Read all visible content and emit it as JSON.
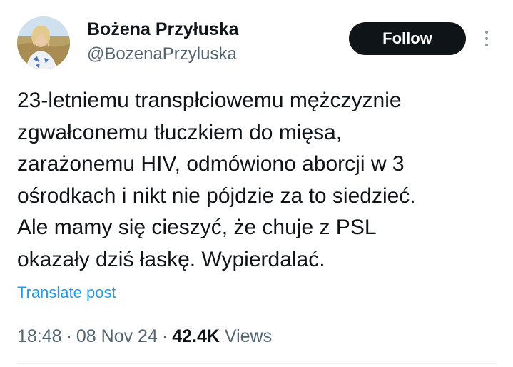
{
  "author": {
    "display_name": "Bożena Przyłuska",
    "handle": "@BozenaPrzyluska",
    "avatar_icon": "profile-photo"
  },
  "actions": {
    "follow_label": "Follow",
    "more_icon": "more-vertical-icon"
  },
  "tweet": {
    "lines": [
      "23-letniemu transpłciowemu mężczyznie",
      "zgwałconemu tłuczkiem do mięsa,",
      "zarażonemu HIV, odmówiono aborcji w 3",
      "ośrodkach i nikt nie pójdzie za to siedzieć.",
      "Ale mamy się cieszyć, że chuje z PSL",
      "okazały dziś łaskę. Wypierdalać."
    ],
    "translate_label": "Translate post"
  },
  "meta": {
    "time": "18:48",
    "date": "08 Nov 24",
    "views_count": "42.4K",
    "views_label": "Views",
    "separator": "·"
  },
  "colors": {
    "text_primary": "#0f1419",
    "text_secondary": "#536471",
    "link": "#1d9bf0",
    "follow_bg": "#0f1419",
    "follow_text": "#ffffff"
  }
}
